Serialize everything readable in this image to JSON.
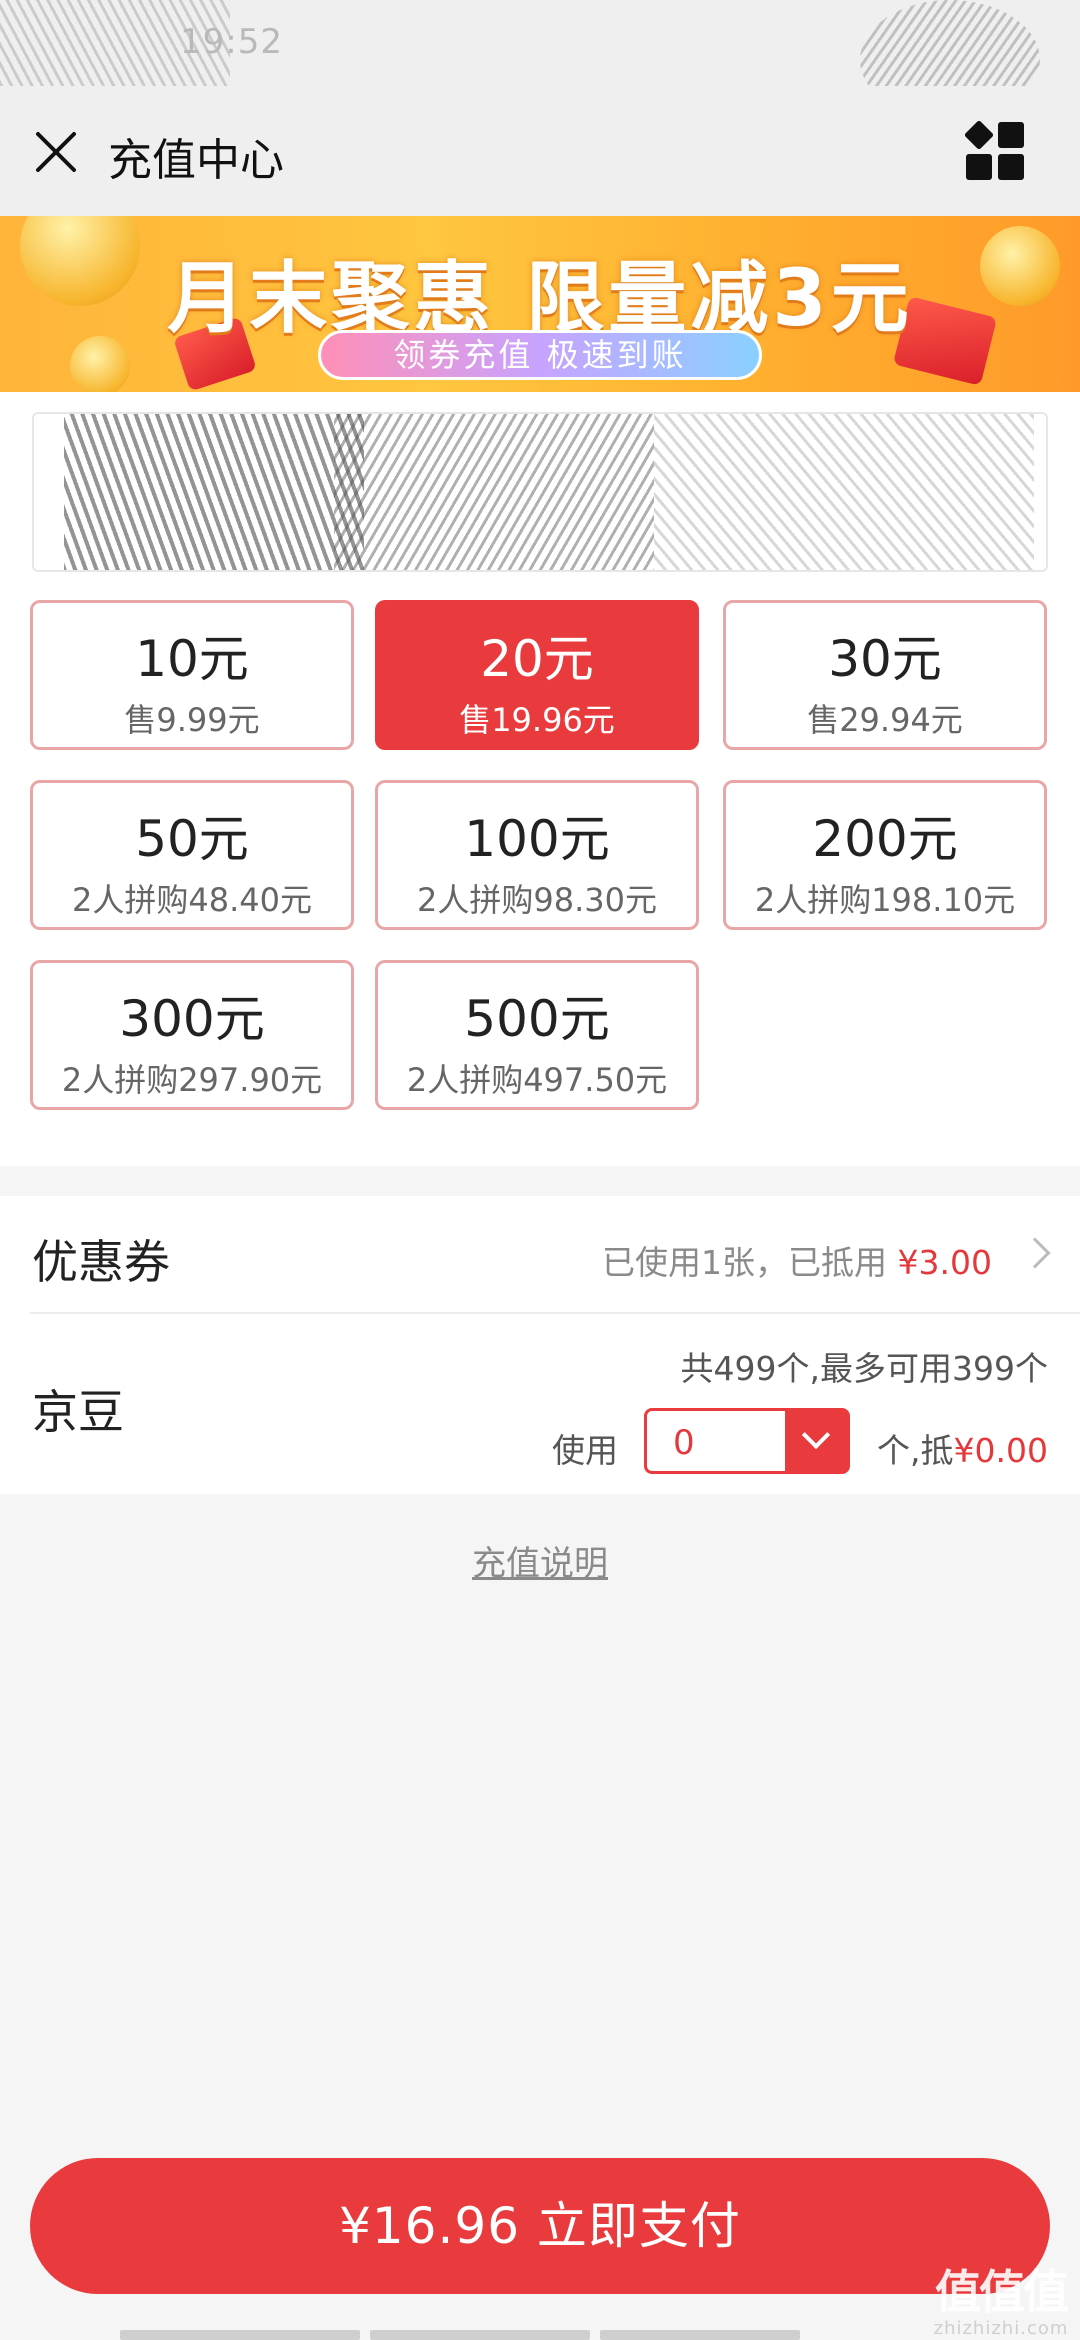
{
  "status_bar": {
    "time": "19:52"
  },
  "title_bar": {
    "title": "充值中心"
  },
  "banner": {
    "headline": "月末聚惠  限量减3元",
    "tagline": "领券充值 极速到账"
  },
  "amount_options": [
    {
      "face": "10元",
      "price": "售9.99元",
      "selected": false
    },
    {
      "face": "20元",
      "price": "售19.96元",
      "selected": true
    },
    {
      "face": "30元",
      "price": "售29.94元",
      "selected": false
    },
    {
      "face": "50元",
      "price": "2人拼购48.40元",
      "selected": false
    },
    {
      "face": "100元",
      "price": "2人拼购98.30元",
      "selected": false
    },
    {
      "face": "200元",
      "price": "2人拼购198.10元",
      "selected": false
    },
    {
      "face": "300元",
      "price": "2人拼购297.90元",
      "selected": false
    },
    {
      "face": "500元",
      "price": "2人拼购497.50元",
      "selected": false
    }
  ],
  "coupon": {
    "label": "优惠券",
    "used_text": "已使用1张，已抵用 ",
    "amount": "¥3.00"
  },
  "jingdou": {
    "label": "京豆",
    "total_text": "共499个,最多可用399个",
    "use_label": "使用",
    "selected_value": "0",
    "unit_text": "个,抵",
    "deduct_amount": "¥0.00"
  },
  "recharge_note": "充值说明",
  "pay_button": "¥16.96 立即支付",
  "watermark": {
    "main": "值值值",
    "sub": "zhizhizhi.com"
  },
  "colors": {
    "accent": "#e93b3d",
    "tile_border": "#e8a6a6",
    "banner": "#ffc63f"
  }
}
